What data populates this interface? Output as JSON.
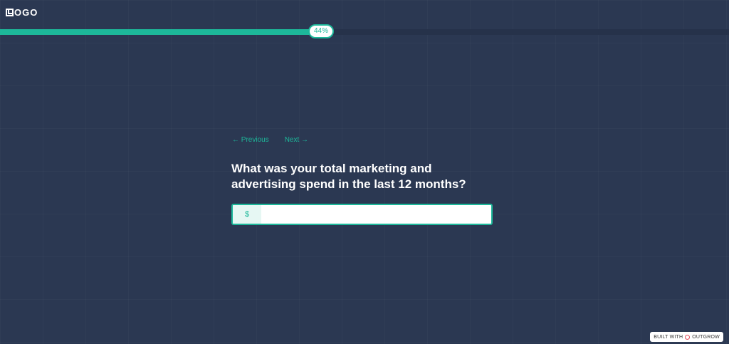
{
  "logo": {
    "text": "OGO"
  },
  "progress": {
    "percent": 44,
    "label": "44%",
    "color": "#1db89a"
  },
  "nav": {
    "previous_label": "← Previous",
    "next_label": "Next →"
  },
  "question": {
    "text": "What was your total marketing and advertising spend in the last 12 months?"
  },
  "input": {
    "prefix": "$",
    "value": "",
    "placeholder": ""
  },
  "footer": {
    "built_with_label": "BUILT WITH",
    "brand_label": "OUTGROW"
  },
  "colors": {
    "background": "#2b3852",
    "accent": "#1db89a",
    "white": "#ffffff"
  }
}
